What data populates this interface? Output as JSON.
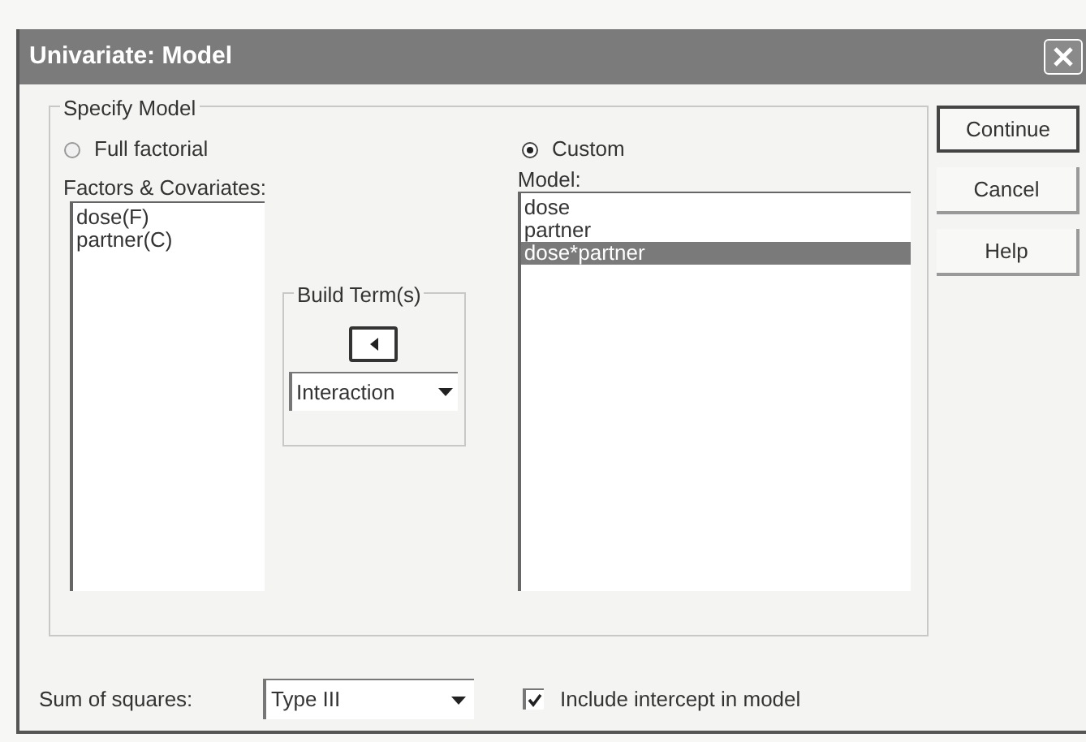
{
  "window": {
    "title": "Univariate: Model"
  },
  "specify_model": {
    "title": "Specify Model",
    "options": [
      {
        "label": "Full factorial",
        "selected": false
      },
      {
        "label": "Custom",
        "selected": true
      }
    ]
  },
  "factors": {
    "label": "Factors & Covariates:",
    "items": [
      {
        "label": "dose(F)",
        "selected": false
      },
      {
        "label": "partner(C)",
        "selected": false
      }
    ]
  },
  "build_terms": {
    "title": "Build Term(s)",
    "type": "Interaction"
  },
  "model": {
    "label": "Model:",
    "items": [
      {
        "label": "dose",
        "selected": false
      },
      {
        "label": "partner",
        "selected": false
      },
      {
        "label": "dose*partner",
        "selected": true
      }
    ]
  },
  "buttons": [
    {
      "label": "Continue",
      "default": true
    },
    {
      "label": "Cancel",
      "default": false
    },
    {
      "label": "Help",
      "default": false
    }
  ],
  "sum_of_squares": {
    "label": "Sum of squares:",
    "value": "Type III"
  },
  "include_intercept": {
    "label": "Include intercept in model",
    "checked": true
  }
}
